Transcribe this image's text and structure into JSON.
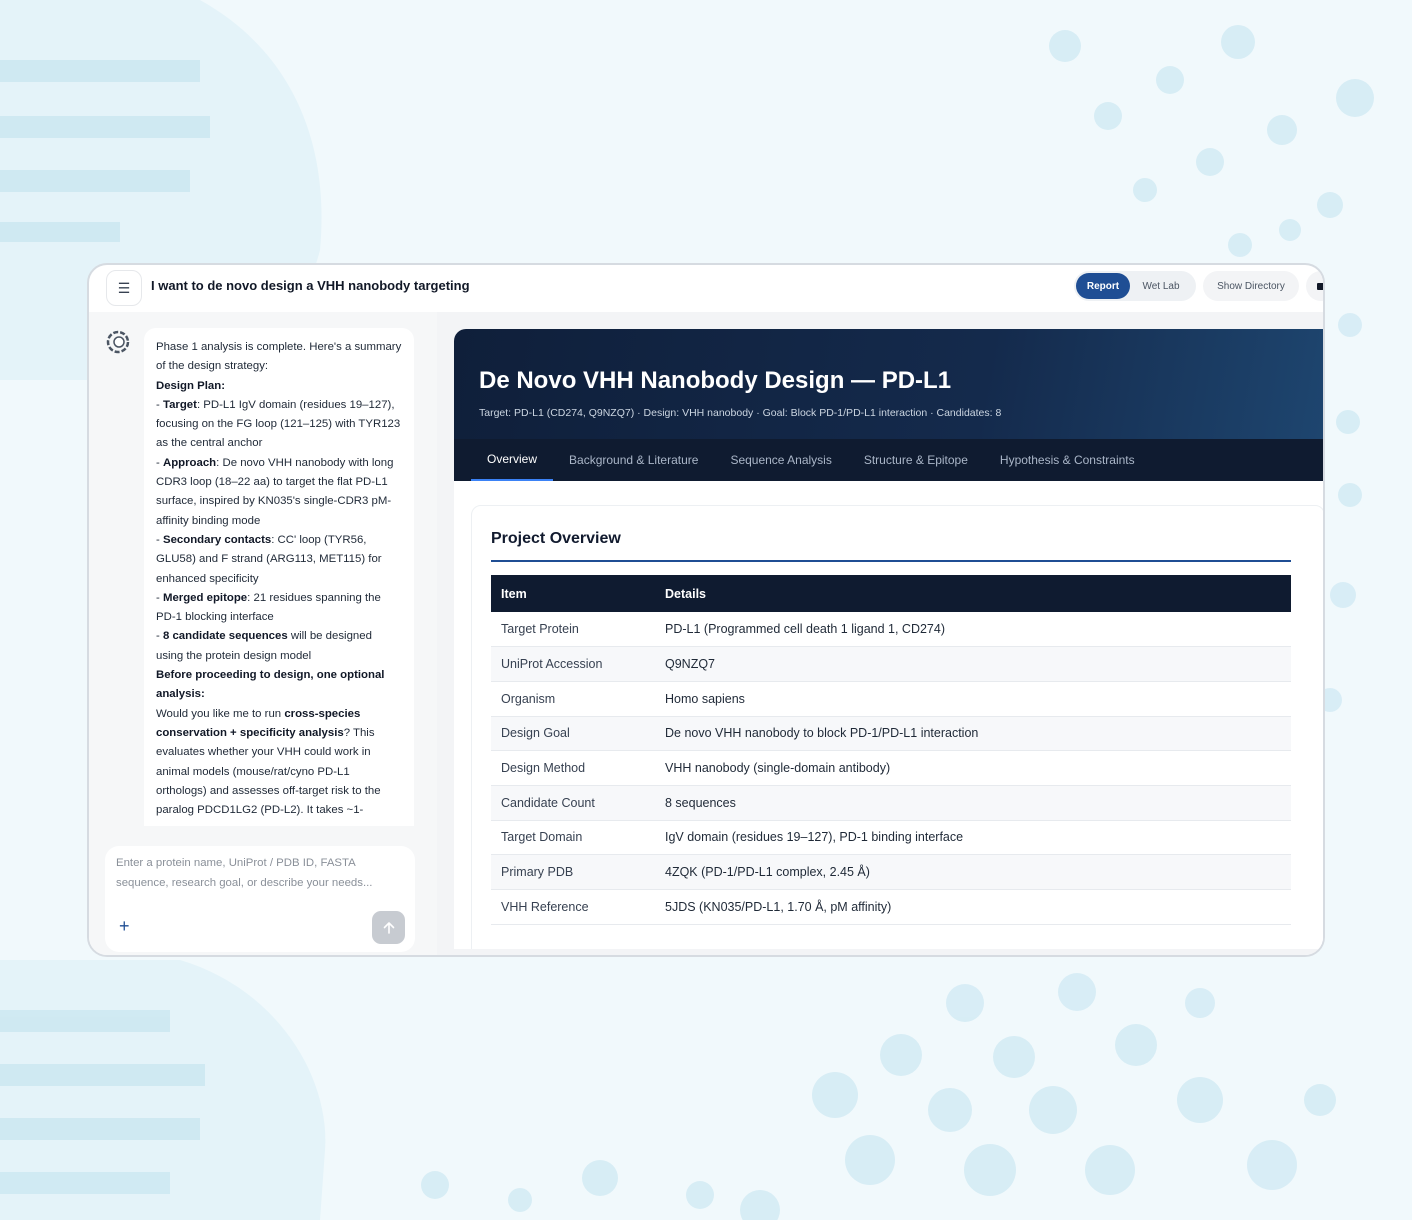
{
  "topbar": {
    "title": "I want to de novo design a VHH nanobody targeting",
    "menu_icon": "hamburger-icon",
    "view_toggle": {
      "active": "Report",
      "inactive": "Wet Lab"
    },
    "show_directory_label": "Show Directory"
  },
  "chat": {
    "avatar_icon": "bot-avatar-icon",
    "message": [
      [
        {
          "t": "Phase 1 analysis is complete. Here's a summary of the design strategy:"
        }
      ],
      [
        {
          "t": "Design Plan:",
          "b": true
        }
      ],
      [
        {
          "t": "- "
        },
        {
          "t": "Target",
          "b": true
        },
        {
          "t": ": PD-L1 IgV domain (residues 19–127), focusing on the FG loop (121–125) with TYR123 as the central anchor"
        }
      ],
      [
        {
          "t": "- "
        },
        {
          "t": "Approach",
          "b": true
        },
        {
          "t": ": De novo VHH nanobody with long CDR3 loop (18–22 aa) to target the flat PD-L1 surface, inspired by KN035's single-CDR3 pM-affinity binding mode"
        }
      ],
      [
        {
          "t": "- "
        },
        {
          "t": "Secondary contacts",
          "b": true
        },
        {
          "t": ": CC' loop (TYR56, GLU58) and F strand (ARG113, MET115) for enhanced specificity"
        }
      ],
      [
        {
          "t": "- "
        },
        {
          "t": "Merged epitope",
          "b": true
        },
        {
          "t": ": 21 residues spanning the PD-1 blocking interface"
        }
      ],
      [
        {
          "t": "- "
        },
        {
          "t": "8 candidate sequences",
          "b": true
        },
        {
          "t": " will be designed using the protein design model"
        }
      ],
      [
        {
          "t": "Before proceeding to design, one optional analysis:",
          "b": true
        }
      ],
      [
        {
          "t": "Would you like me to run "
        },
        {
          "t": "cross-species conservation + specificity analysis",
          "b": true
        },
        {
          "t": "? This evaluates whether your VHH could work in animal models (mouse/rat/cyno PD-L1 orthologs) and assesses off-target risk to the paralog PDCD1LG2 (PD-L2). It takes ~1-"
        }
      ]
    ],
    "input_placeholder": "Enter a protein name, UniProt / PDB ID, FASTA sequence, research goal, or describe your needs...",
    "plus_label": "+",
    "send_icon": "arrow-up-icon"
  },
  "report": {
    "title": "De Novo VHH Nanobody Design — PD-L1",
    "subtitle": "Target: PD-L1 (CD274, Q9NZQ7) · Design: VHH nanobody · Goal: Block PD-1/PD-L1 interaction · Candidates: 8",
    "tabs": [
      "Overview",
      "Background & Literature",
      "Sequence Analysis",
      "Structure & Epitope",
      "Hypothesis & Constraints"
    ],
    "active_tab": "Overview",
    "section_title": "Project Overview",
    "table": {
      "headers": [
        "Item",
        "Details"
      ],
      "rows": [
        [
          "Target Protein",
          "PD-L1 (Programmed cell death 1 ligand 1, CD274)"
        ],
        [
          "UniProt Accession",
          "Q9NZQ7"
        ],
        [
          "Organism",
          "Homo sapiens"
        ],
        [
          "Design Goal",
          "De novo VHH nanobody to block PD-1/PD-L1 interaction"
        ],
        [
          "Design Method",
          "VHH nanobody (single-domain antibody)"
        ],
        [
          "Candidate Count",
          "8 sequences"
        ],
        [
          "Target Domain",
          "IgV domain (residues 19–127), PD-1 binding interface"
        ],
        [
          "Primary PDB",
          "4ZQK (PD-1/PD-L1 complex, 2.45 Å)"
        ],
        [
          "VHH Reference",
          "5JDS (KN035/PD-L1, 1.70 Å, pM affinity)"
        ]
      ]
    }
  },
  "colors": {
    "accent": "#1f4e94",
    "header_dark": "#0f1b30",
    "background": "#f1f9fc",
    "decoration": "#d8eef6"
  }
}
